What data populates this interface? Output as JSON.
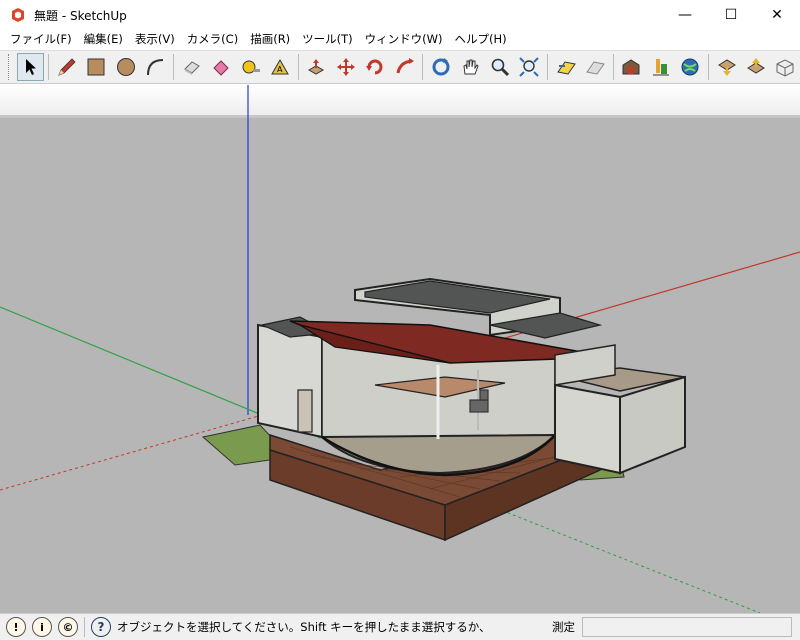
{
  "window": {
    "title": "無題 - SketchUp",
    "controls": {
      "minimize": "—",
      "maximize": "☐",
      "close": "✕"
    }
  },
  "menu": [
    {
      "label": "ファイル(F)"
    },
    {
      "label": "編集(E)"
    },
    {
      "label": "表示(V)"
    },
    {
      "label": "カメラ(C)"
    },
    {
      "label": "描画(R)"
    },
    {
      "label": "ツール(T)"
    },
    {
      "label": "ウィンドウ(W)"
    },
    {
      "label": "ヘルプ(H)"
    }
  ],
  "toolbar": {
    "tools": [
      "select-tool",
      "pencil-tool",
      "rectangle-tool",
      "circle-tool",
      "arc-tool",
      "eraser-tool",
      "paint-bucket-tool",
      "tape-measure-tool",
      "paint-tool",
      "push-pull-tool",
      "move-tool",
      "rotate-tool",
      "follow-me-tool",
      "orbit-tool",
      "pan-tool",
      "zoom-tool",
      "zoom-extents-tool",
      "previous-view-tool",
      "next-view-tool",
      "3d-warehouse-tool",
      "extension-warehouse-tool",
      "geo-location-tool",
      "share-model-tool",
      "get-models-tool",
      "layout-tool"
    ]
  },
  "colors": {
    "sky": "#ffffff",
    "ground": "#b6b6b6",
    "horizon": "#cfcfcf",
    "axis_red": "#c0392b",
    "axis_green": "#2ea043",
    "axis_blue": "#1f3fd1",
    "deck": "#7a4a35",
    "roof_red": "#7e2a22"
  },
  "status": {
    "message": "オブジェクトを選択してください。Shift キーを押したまま選択するか、",
    "measure_label": "測定",
    "measure_value": ""
  }
}
